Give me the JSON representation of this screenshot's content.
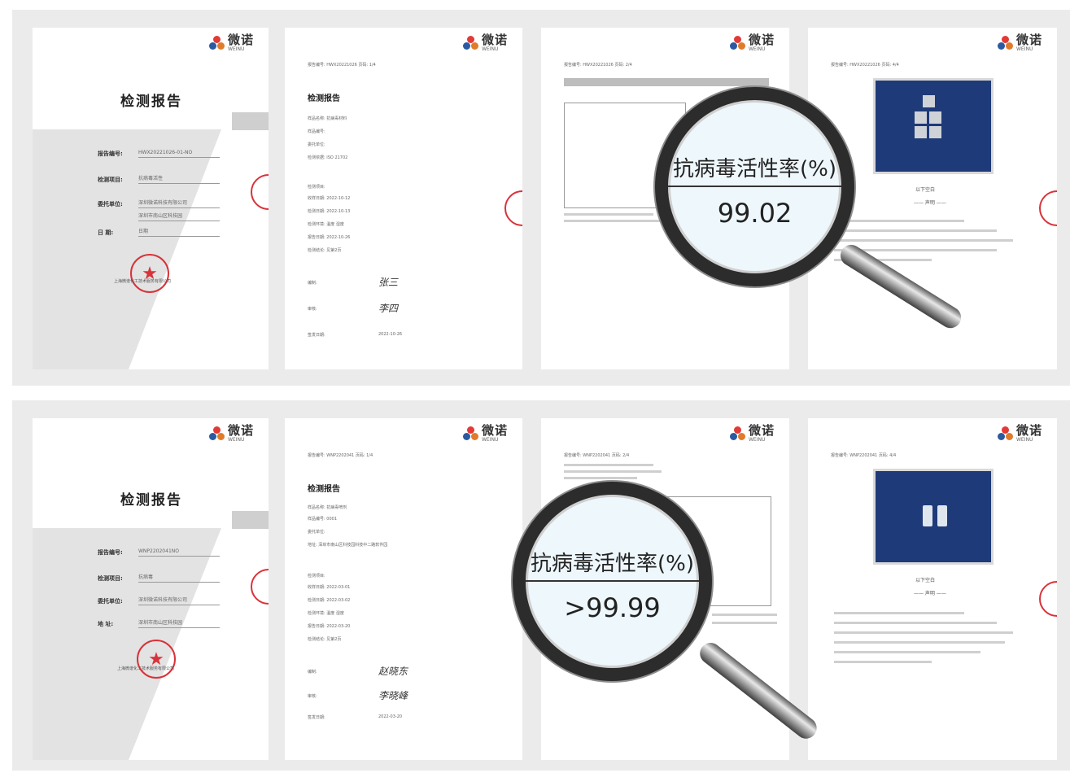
{
  "brand": {
    "name_cn": "微诺",
    "name_en": "WEINU"
  },
  "rows": [
    {
      "cover": {
        "title": "检测报告",
        "fields": [
          {
            "key": "报告编号:",
            "value": "HWX20221026-01-NO"
          },
          {
            "key": "检测项目:",
            "value": "抗病毒活性"
          },
          {
            "key": "委托单位:",
            "value": "深圳微诺科技有限公司"
          },
          {
            "key": "",
            "value": "深圳市南山区科技园"
          },
          {
            "key": "日 期:",
            "value": "日期"
          }
        ],
        "seal_caption": "上海微谱化工技术服务有限公司"
      },
      "text_page": {
        "header": "报告编号: HWX20221026  页码: 1/4",
        "title": "检测报告",
        "lines": [
          "样品名称: 抗病毒材料",
          "样品编号: ",
          "委托单位: ",
          "检测依据: ISO 21702",
          "检测项目:",
          "收样日期: 2022-10-12",
          "检测日期: 2022-10-13",
          "检测环境: 温度 湿度",
          "报告日期: 2022-10-26",
          "检测结论: 见第2页"
        ],
        "sign": [
          {
            "key": "编制:",
            "value": "张三"
          },
          {
            "key": "审核:",
            "value": "李四"
          },
          {
            "key": "签发日期:",
            "value": "2022-10-26"
          }
        ]
      },
      "result_page": {
        "header": "报告编号: HWX20221026  页码: 2/4"
      },
      "photo_page": {
        "header": "报告编号: HWX20221026  页码: 4/4",
        "caption": "以下空白",
        "caption2": "—— 声明 ——"
      },
      "magnifier": {
        "label": "抗病毒活性率(%)",
        "value": "99.02"
      }
    },
    {
      "cover": {
        "title": "检测报告",
        "fields": [
          {
            "key": "报告编号:",
            "value": "WNP2202041NO"
          },
          {
            "key": "检测项目:",
            "value": "抗病毒"
          },
          {
            "key": "委托单位:",
            "value": "深圳微诺科技有限公司"
          },
          {
            "key": "地 址:",
            "value": "深圳市南山区科技园"
          }
        ],
        "seal_caption": "上海微谱化工技术服务有限公司"
      },
      "text_page": {
        "header": "报告编号: WNP2202041  页码: 1/4",
        "title": "检测报告",
        "lines": [
          "样品名称: 抗病毒喷剂",
          "样品编号: 0001",
          "委托单位:",
          "地址: 深圳市南山区科技园科技中二路软件园",
          "检测项目:",
          "收样日期: 2022-03-01",
          "检测日期: 2022-03-02",
          "检测环境: 温度 湿度",
          "报告日期: 2022-03-20",
          "检测结论: 见第2页"
        ],
        "sign": [
          {
            "key": "编制:",
            "value": "赵晓东"
          },
          {
            "key": "审核:",
            "value": "李晓峰"
          },
          {
            "key": "签发日期:",
            "value": "2022-03-20"
          }
        ]
      },
      "result_page": {
        "header": "报告编号: WNP2202041  页码: 2/4"
      },
      "photo_page": {
        "header": "报告编号: WNP2202041  页码: 4/4",
        "caption": "以下空白",
        "caption2": "—— 声明 ——"
      },
      "magnifier": {
        "label": "抗病毒活性率(%)",
        "value": ">99.99"
      }
    }
  ]
}
